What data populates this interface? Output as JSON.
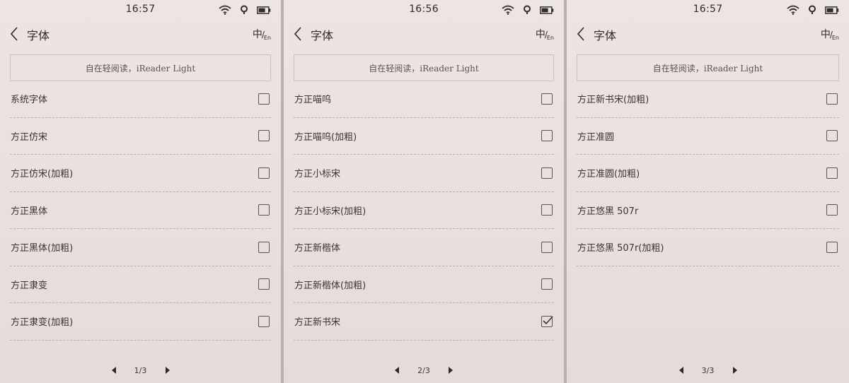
{
  "screens": [
    {
      "status": {
        "time": "16:57"
      },
      "header": {
        "title": "字体",
        "lang_zh": "中",
        "lang_sep": "/",
        "lang_en": "En"
      },
      "preview_text": "自在轻阅读，iReader Light",
      "fonts": [
        {
          "name": "系统字体",
          "checked": false
        },
        {
          "name": "方正仿宋",
          "checked": false
        },
        {
          "name": "方正仿宋(加粗)",
          "checked": false
        },
        {
          "name": "方正黑体",
          "checked": false
        },
        {
          "name": "方正黑体(加粗)",
          "checked": false
        },
        {
          "name": "方正隶变",
          "checked": false
        },
        {
          "name": "方正隶变(加粗)",
          "checked": false
        }
      ],
      "pager": {
        "label": "1/3"
      }
    },
    {
      "status": {
        "time": "16:56"
      },
      "header": {
        "title": "字体",
        "lang_zh": "中",
        "lang_sep": "/",
        "lang_en": "En"
      },
      "preview_text": "自在轻阅读，iReader Light",
      "fonts": [
        {
          "name": "方正喵呜",
          "checked": false
        },
        {
          "name": "方正喵呜(加粗)",
          "checked": false
        },
        {
          "name": "方正小标宋",
          "checked": false
        },
        {
          "name": "方正小标宋(加粗)",
          "checked": false
        },
        {
          "name": "方正新楷体",
          "checked": false
        },
        {
          "name": "方正新楷体(加粗)",
          "checked": false
        },
        {
          "name": "方正新书宋",
          "checked": true
        }
      ],
      "pager": {
        "label": "2/3"
      }
    },
    {
      "status": {
        "time": "16:57"
      },
      "header": {
        "title": "字体",
        "lang_zh": "中",
        "lang_sep": "/",
        "lang_en": "En"
      },
      "preview_text": "自在轻阅读，iReader Light",
      "fonts": [
        {
          "name": "方正新书宋(加粗)",
          "checked": false
        },
        {
          "name": "方正准圆",
          "checked": false
        },
        {
          "name": "方正准圆(加粗)",
          "checked": false
        },
        {
          "name": "方正悠黑 507r",
          "checked": false
        },
        {
          "name": "方正悠黑 507r(加粗)",
          "checked": false
        }
      ],
      "pager": {
        "label": "3/3"
      }
    }
  ],
  "icons": {
    "wifi": "wifi-icon",
    "location": "location-icon",
    "battery": "battery-icon",
    "back": "back-arrow-icon",
    "prev": "prev-page-icon",
    "next": "next-page-icon",
    "check": "checkmark-icon"
  }
}
